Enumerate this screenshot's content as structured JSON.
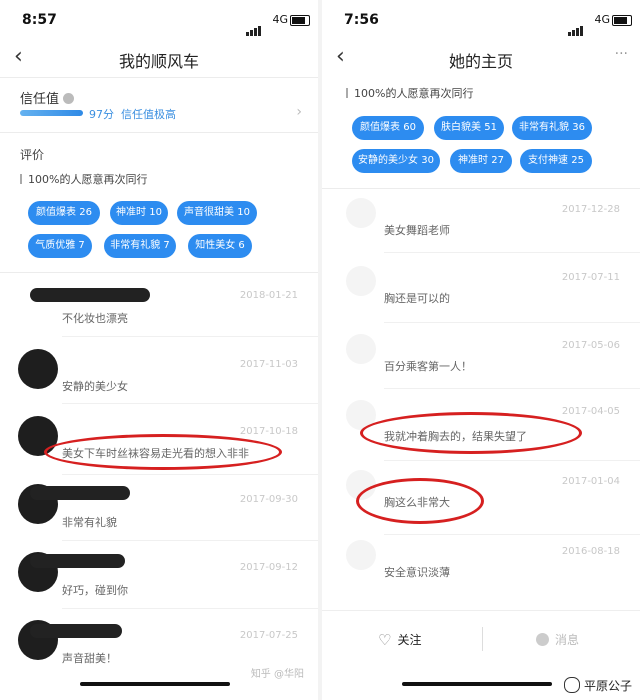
{
  "left": {
    "status": {
      "time": "8:57",
      "net": "4G"
    },
    "nav": {
      "title": "我的顺风车"
    },
    "trust": {
      "label": "信任值",
      "score_text": "97分",
      "level_text": "信任值极高",
      "progress": 0.97
    },
    "review": {
      "label": "评价",
      "ratio": "100%的人愿意再次同行"
    },
    "tags": [
      "颜值爆表 26",
      "神准时 10",
      "声音很甜美 10",
      "气质优雅 7",
      "非常有礼貌 7",
      "知性美女 6"
    ],
    "comments": [
      {
        "date": "2018-01-21",
        "text": "不化妆也漂亮"
      },
      {
        "date": "2017-11-03",
        "text": "安静的美少女"
      },
      {
        "date": "2017-10-18",
        "text": "美女下车时丝袜容易走光看的想入非非"
      },
      {
        "date": "2017-09-30",
        "text": "非常有礼貌"
      },
      {
        "date": "2017-09-12",
        "text": "好巧，碰到你"
      },
      {
        "date": "2017-07-25",
        "text": "声音甜美！"
      }
    ],
    "watermark": "知乎 @华阳"
  },
  "right": {
    "status": {
      "time": "7:56",
      "net": "4G"
    },
    "nav": {
      "title": "她的主页",
      "more": "···"
    },
    "review": {
      "ratio": "100%的人愿意再次同行"
    },
    "tags": [
      "颜值爆表 60",
      "肤白貌美 51",
      "非常有礼貌 36",
      "安静的美少女 30",
      "神准时 27",
      "支付神速 25"
    ],
    "comments": [
      {
        "date": "2017-12-28",
        "text": "美女舞蹈老师"
      },
      {
        "date": "2017-07-11",
        "text": "胸还是可以的"
      },
      {
        "date": "2017-05-06",
        "text": "百分乘客第一人！"
      },
      {
        "date": "2017-04-05",
        "text": "我就冲着胸去的，结果失望了"
      },
      {
        "date": "2017-01-04",
        "text": "胸这么非常大"
      },
      {
        "date": "2016-08-18",
        "text": "安全意识淡薄"
      }
    ],
    "bottom": {
      "follow": "关注",
      "message": "消息"
    },
    "watermark": "平原公子"
  },
  "colors": {
    "accent": "#2d8cf0",
    "highlight": "#d62020"
  }
}
